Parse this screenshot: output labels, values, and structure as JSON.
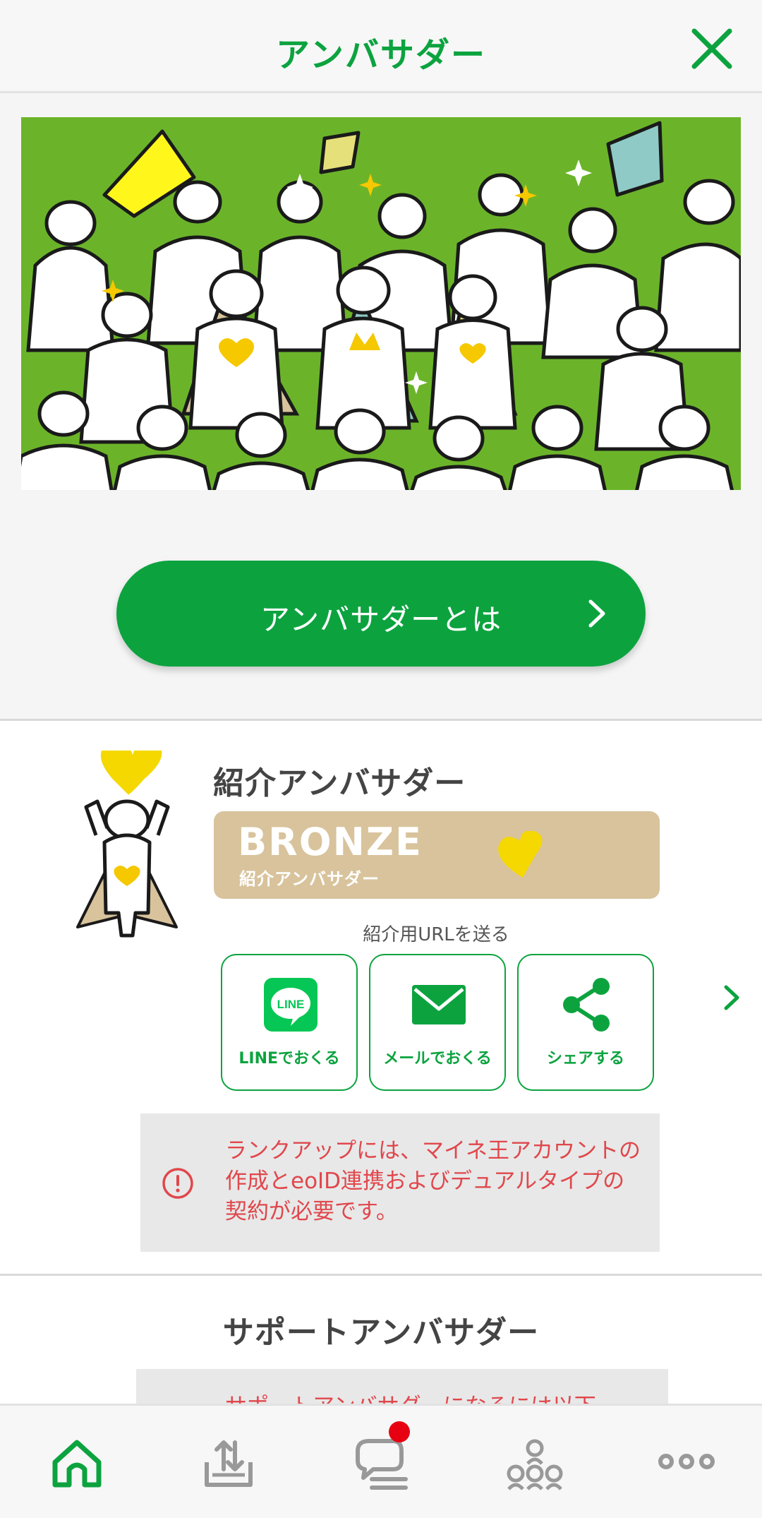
{
  "header": {
    "title": "アンバサダー",
    "close_icon": "close-icon"
  },
  "about_button": {
    "label": "アンバサダーとは"
  },
  "referral": {
    "title": "紹介アンバサダー",
    "rank": {
      "name": "BRONZE",
      "subtitle": "紹介アンバサダー",
      "color": "#d8c39c"
    },
    "share_caption": "紹介用URLを送る",
    "share_buttons": [
      {
        "label": "LINEでおくる",
        "icon": "line-icon",
        "icon_text": "LINE"
      },
      {
        "label": "メールでおくる",
        "icon": "mail-icon"
      },
      {
        "label": "シェアする",
        "icon": "share-icon"
      }
    ],
    "notice": "ランクアップには、マイネ王アカウントの作成とeoID連携およびデュアルタイプの契約が必要です。"
  },
  "support": {
    "title": "サポートアンバサダー",
    "notice": "サポートアンバサダーになるには以下"
  },
  "bottom_nav": [
    {
      "icon": "home-icon",
      "active": true
    },
    {
      "icon": "upload-icon",
      "active": false
    },
    {
      "icon": "chat-icon",
      "active": false,
      "badge": true
    },
    {
      "icon": "community-icon",
      "active": false
    },
    {
      "icon": "more-icon",
      "active": false
    }
  ],
  "colors": {
    "accent": "#0ca33f",
    "warning": "#e0474c",
    "badge": "#e60012",
    "hero_bg": "#6bb42a"
  }
}
